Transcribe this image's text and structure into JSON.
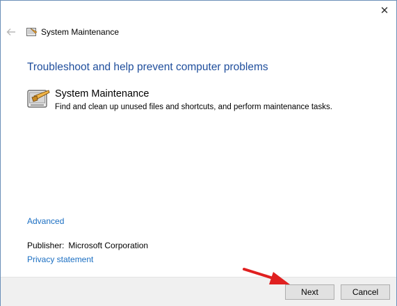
{
  "window": {
    "title": "System Maintenance",
    "close_glyph": "✕",
    "back_icon": "back-arrow-icon"
  },
  "main": {
    "heading": "Troubleshoot and help prevent computer problems",
    "tool": {
      "name": "System Maintenance",
      "description": "Find and clean up unused files and shortcuts, and perform maintenance tasks.",
      "icon": "maintenance-tool-icon"
    },
    "advanced_link": "Advanced",
    "publisher_label": "Publisher:",
    "publisher_value": "Microsoft Corporation",
    "privacy_link": "Privacy statement"
  },
  "footer": {
    "next_label": "Next",
    "cancel_label": "Cancel"
  },
  "colors": {
    "heading": "#1f4e9c",
    "link": "#1a6ec2",
    "annotation_arrow": "#e02020"
  }
}
